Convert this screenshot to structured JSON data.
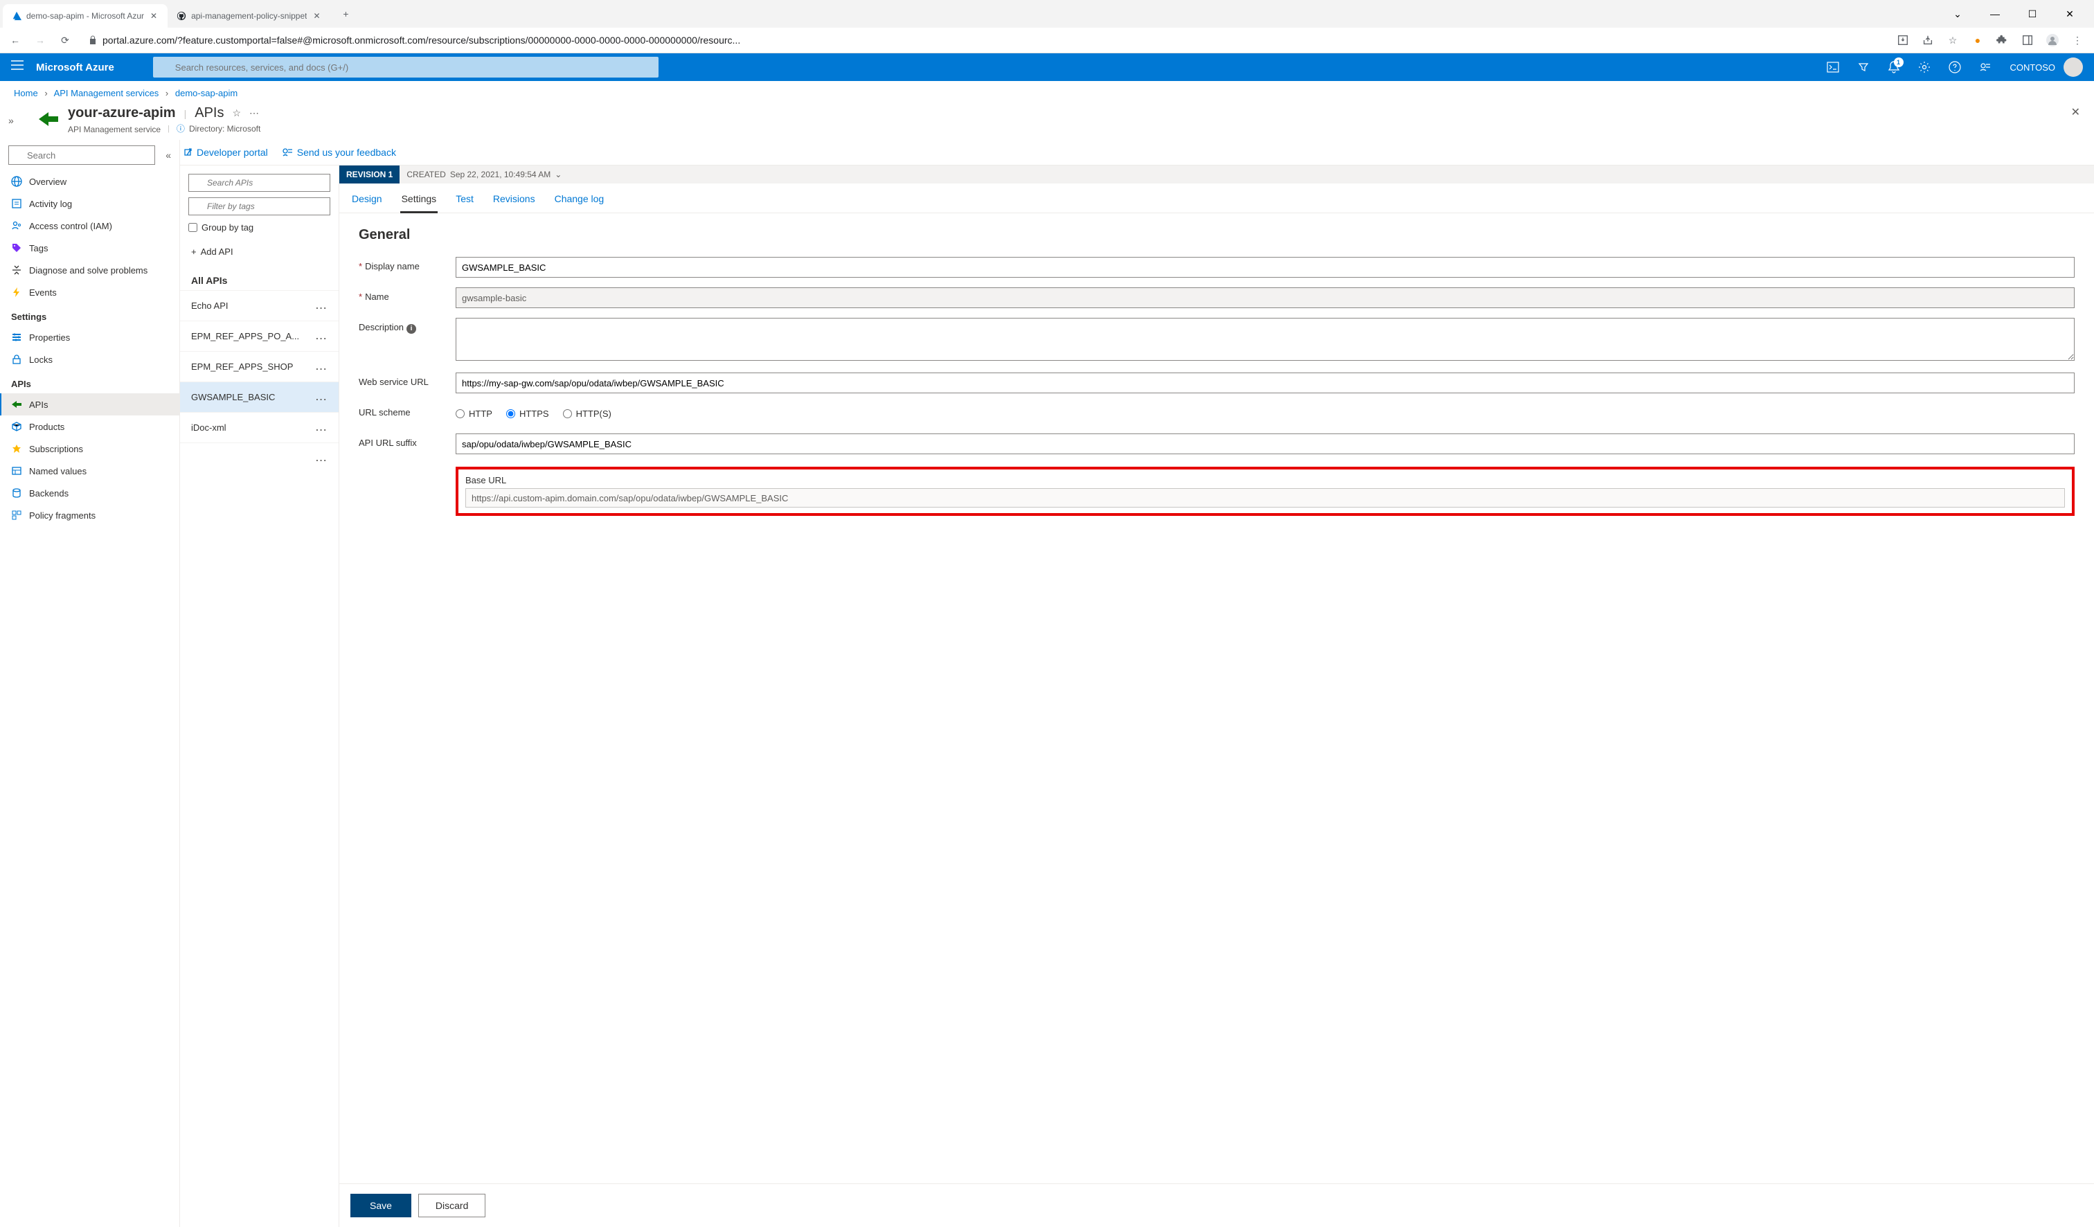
{
  "browser": {
    "tabs": [
      {
        "title": "demo-sap-apim - Microsoft Azur",
        "favicon": "azure"
      },
      {
        "title": "api-management-policy-snippet",
        "favicon": "github"
      }
    ],
    "url": "portal.azure.com/?feature.customportal=false#@microsoft.onmicrosoft.com/resource/subscriptions/00000000-0000-0000-0000-000000000/resourc..."
  },
  "azure_header": {
    "brand": "Microsoft Azure",
    "search_placeholder": "Search resources, services, and docs (G+/)",
    "tenant": "CONTOSO",
    "notif_count": "1"
  },
  "breadcrumb": {
    "home": "Home",
    "service": "API Management services",
    "resource": "demo-sap-apim"
  },
  "resource": {
    "name": "your-azure-apim",
    "section": "APIs",
    "subtitle": "API Management service",
    "directory_label": "Directory: Microsoft"
  },
  "left_nav": {
    "search_placeholder": "Search",
    "items_top": [
      {
        "icon": "globe",
        "label": "Overview",
        "color": "#0078d4"
      },
      {
        "icon": "log",
        "label": "Activity log",
        "color": "#0078d4"
      },
      {
        "icon": "iam",
        "label": "Access control (IAM)",
        "color": "#0078d4"
      },
      {
        "icon": "tag",
        "label": "Tags",
        "color": "#7b2ff7"
      },
      {
        "icon": "diag",
        "label": "Diagnose and solve problems",
        "color": "#323130"
      },
      {
        "icon": "event",
        "label": "Events",
        "color": "#ffb900"
      }
    ],
    "section_settings": "Settings",
    "items_settings": [
      {
        "icon": "props",
        "label": "Properties",
        "color": "#0078d4"
      },
      {
        "icon": "lock",
        "label": "Locks",
        "color": "#0078d4"
      }
    ],
    "section_apis": "APIs",
    "items_apis": [
      {
        "icon": "api",
        "label": "APIs",
        "color": "#107c10",
        "selected": true
      },
      {
        "icon": "product",
        "label": "Products",
        "color": "#0078d4"
      },
      {
        "icon": "sub",
        "label": "Subscriptions",
        "color": "#ffb900"
      },
      {
        "icon": "named",
        "label": "Named values",
        "color": "#0078d4"
      },
      {
        "icon": "backend",
        "label": "Backends",
        "color": "#0078d4"
      },
      {
        "icon": "frag",
        "label": "Policy fragments",
        "color": "#0078d4"
      }
    ]
  },
  "api_toolbar": {
    "dev_portal": "Developer portal",
    "feedback": "Send us your feedback"
  },
  "api_col": {
    "search_placeholder": "Search APIs",
    "filter_placeholder": "Filter by tags",
    "group_label": "Group by tag",
    "add_label": "Add API",
    "all_label": "All APIs",
    "items": [
      {
        "label": "Echo API"
      },
      {
        "label": "EPM_REF_APPS_PO_A..."
      },
      {
        "label": "EPM_REF_APPS_SHOP"
      },
      {
        "label": "GWSAMPLE_BASIC",
        "selected": true
      },
      {
        "label": "iDoc-xml"
      },
      {
        "label": ""
      }
    ]
  },
  "revision": {
    "badge": "REVISION 1",
    "created_label": "CREATED",
    "created_value": "Sep 22, 2021, 10:49:54 AM"
  },
  "detail_tabs": [
    "Design",
    "Settings",
    "Test",
    "Revisions",
    "Change log"
  ],
  "detail_tab_active": "Settings",
  "form": {
    "section": "General",
    "labels": {
      "display_name": "Display name",
      "name": "Name",
      "description": "Description",
      "web_service_url": "Web service URL",
      "url_scheme": "URL scheme",
      "api_url_suffix": "API URL suffix",
      "base_url": "Base URL"
    },
    "values": {
      "display_name": "GWSAMPLE_BASIC",
      "name": "gwsample-basic",
      "description": "",
      "web_service_url": "https://my-sap-gw.com/sap/opu/odata/iwbep/GWSAMPLE_BASIC",
      "api_url_suffix": "sap/opu/odata/iwbep/GWSAMPLE_BASIC",
      "base_url": "https://api.custom-apim.domain.com/sap/opu/odata/iwbep/GWSAMPLE_BASIC"
    },
    "url_scheme_options": [
      "HTTP",
      "HTTPS",
      "HTTP(S)"
    ],
    "url_scheme_selected": "HTTPS"
  },
  "buttons": {
    "save": "Save",
    "discard": "Discard"
  }
}
